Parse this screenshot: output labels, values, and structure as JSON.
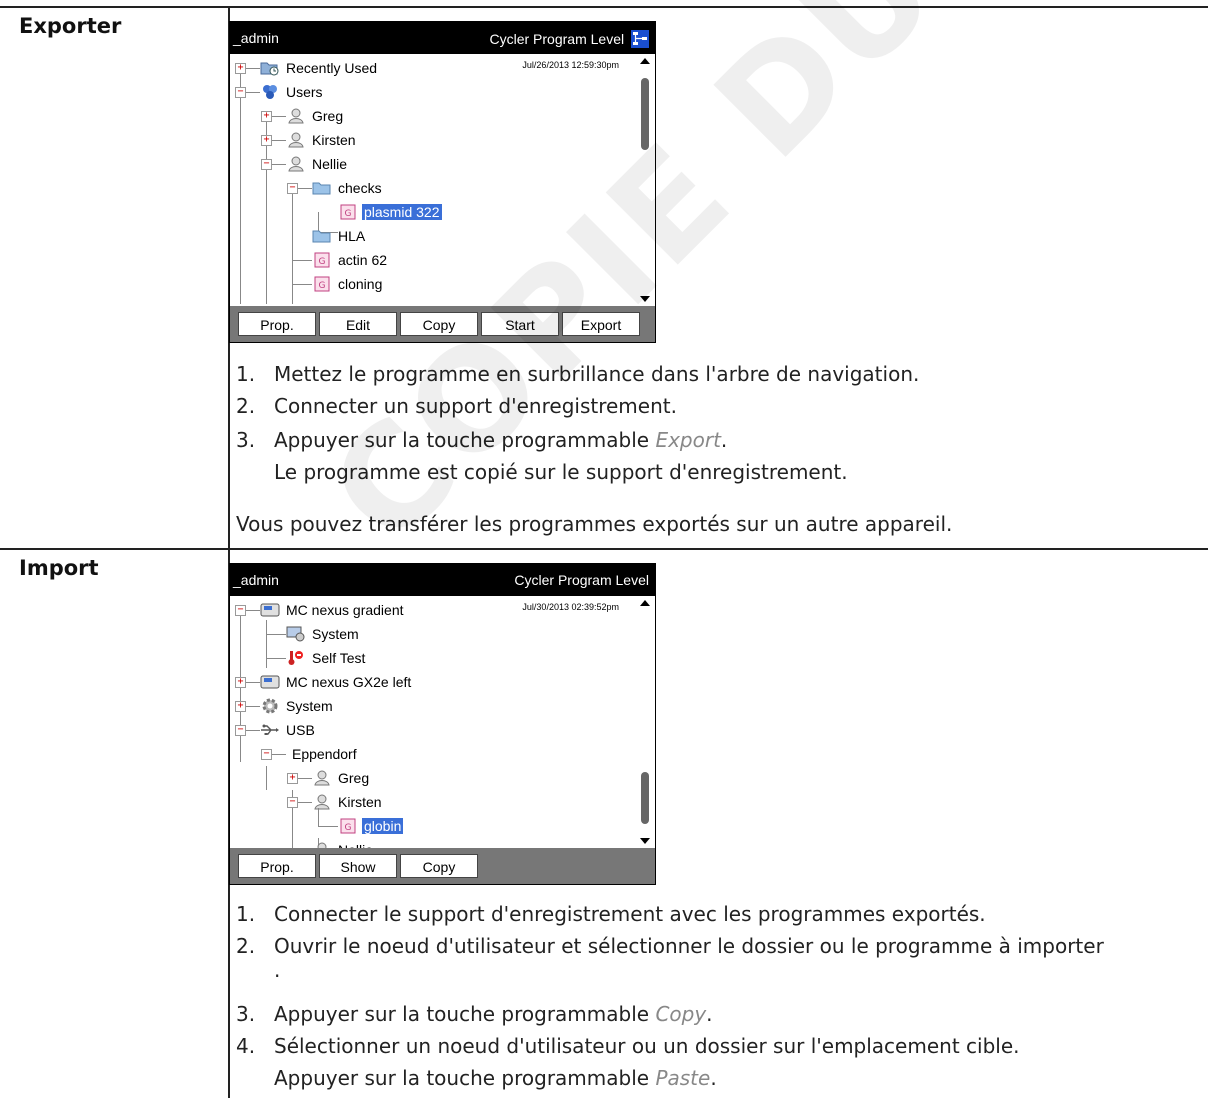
{
  "sections": {
    "export": {
      "label": "Exporter",
      "screen": {
        "title_left": "_admin",
        "title_right": "Cycler Program Level",
        "date": "Jul/26/2013 12:59:30pm",
        "tree": [
          {
            "label": "Recently Used",
            "icon": "recent-icon"
          },
          {
            "label": "Users",
            "icon": "users-icon"
          },
          {
            "label": "Greg",
            "icon": "user-icon"
          },
          {
            "label": "Kirsten",
            "icon": "user-icon"
          },
          {
            "label": "Nellie",
            "icon": "user-icon"
          },
          {
            "label": "checks",
            "icon": "folder-icon"
          },
          {
            "label": "plasmid 322",
            "icon": "program-icon",
            "selected": true
          },
          {
            "label": "HLA",
            "icon": "folder-icon"
          },
          {
            "label": "actin 62",
            "icon": "program-icon"
          },
          {
            "label": "cloning",
            "icon": "program-icon"
          }
        ],
        "softkeys": [
          "Prop.",
          "Edit",
          "Copy",
          "Start",
          "Export"
        ]
      },
      "steps": [
        {
          "num": "1.",
          "text": "Mettez le programme en surbrillance dans l'arbre de navigation."
        },
        {
          "num": "2.",
          "text": "Connecter un support d'enregistrement."
        },
        {
          "num": "3.",
          "text_before": "Appuyer sur la touche programmable ",
          "italic": "Export",
          "text_after": "."
        }
      ],
      "result": "Le programme est copié sur le support d'enregistrement.",
      "note": "Vous pouvez transférer les programmes exportés sur un autre appareil."
    },
    "import": {
      "label": "Import",
      "screen": {
        "title_left": "_admin",
        "title_right": "Cycler Program Level",
        "date": "Jul/30/2013 02:39:52pm",
        "tree": [
          {
            "label": "MC nexus gradient",
            "icon": "device-icon"
          },
          {
            "label": "System",
            "icon": "system-icon"
          },
          {
            "label": "Self Test",
            "icon": "selftest-icon"
          },
          {
            "label": "MC nexus GX2e left",
            "icon": "device-icon"
          },
          {
            "label": "System",
            "icon": "gear-icon"
          },
          {
            "label": "USB",
            "icon": "usb-icon"
          },
          {
            "label": "Eppendorf",
            "icon": "none"
          },
          {
            "label": "Greg",
            "icon": "user-icon"
          },
          {
            "label": "Kirsten",
            "icon": "user-icon"
          },
          {
            "label": "globin",
            "icon": "program-icon",
            "selected": true
          },
          {
            "label": "Nellie",
            "icon": "user-icon"
          }
        ],
        "softkeys": [
          "Prop.",
          "Show",
          "Copy"
        ]
      },
      "steps": [
        {
          "num": "1.",
          "text": "Connecter le support d'enregistrement avec les programmes exportés."
        },
        {
          "num": "2.",
          "text": "Ouvrir le noeud d'utilisateur et sélectionner le dossier ou le programme à importer",
          "text2": "."
        },
        {
          "num": "3.",
          "text_before": "Appuyer sur la touche programmable ",
          "italic": "Copy",
          "text_after": "."
        },
        {
          "num": "4.",
          "text": "Sélectionner un noeud d'utilisateur ou un dossier sur l'emplacement cible."
        }
      ],
      "result_before": "Appuyer sur la touche programmable ",
      "result_italic": "Paste",
      "result_after": "."
    }
  },
  "watermark": "COPIE DUTSCHER SA"
}
